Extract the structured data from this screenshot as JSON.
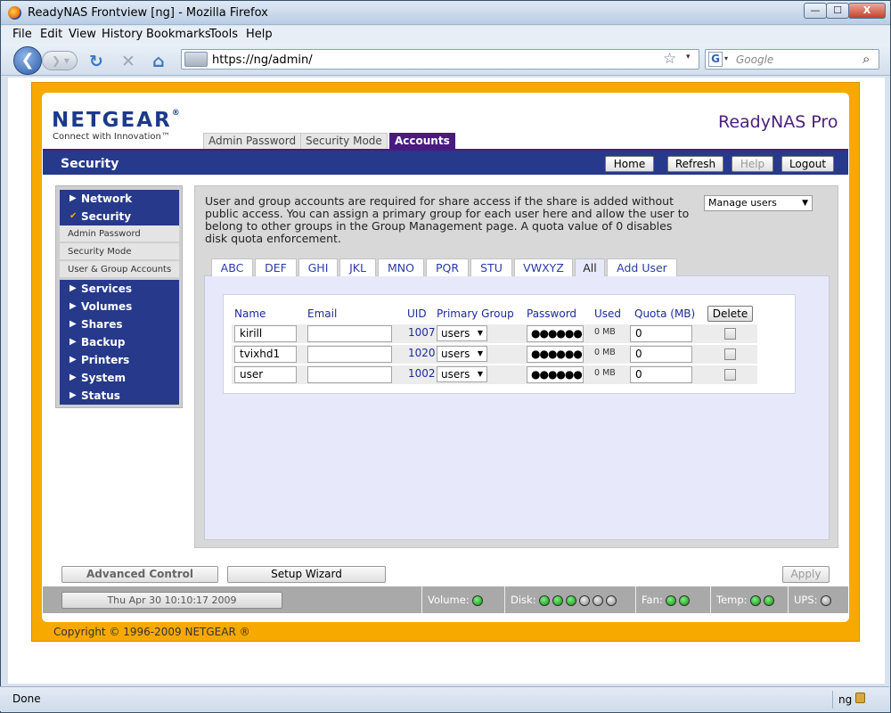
{
  "window": {
    "title": "ReadyNAS Frontview [ng] - Mozilla Firefox",
    "min": "—",
    "max": "☐",
    "close": "X"
  },
  "menu": [
    "File",
    "Edit",
    "View",
    "History",
    "Bookmarks",
    "Tools",
    "Help"
  ],
  "nav": {
    "url": "https://ng/admin/",
    "search_placeholder": "Google"
  },
  "header": {
    "logo": "NETGEAR",
    "tagline": "Connect with Innovation™",
    "product": "ReadyNAS Pro"
  },
  "top_tabs": [
    {
      "label": "Admin Password",
      "active": false
    },
    {
      "label": "Security Mode",
      "active": false
    },
    {
      "label": "Accounts",
      "active": true
    }
  ],
  "section_title": "Security",
  "header_buttons": {
    "home": "Home",
    "refresh": "Refresh",
    "help": "Help",
    "logout": "Logout"
  },
  "sidebar": {
    "network": "Network",
    "security": "Security",
    "sub": [
      "Admin Password",
      "Security Mode",
      "User & Group Accounts"
    ],
    "services": "Services",
    "volumes": "Volumes",
    "shares": "Shares",
    "backup": "Backup",
    "printers": "Printers",
    "system": "System",
    "status": "Status"
  },
  "intro": "User and group accounts are required for share access if the share is added without public access. You can assign a primary group for each user here and allow the user to belong to other groups in the Group Management page. A quota value of 0 disables disk quota enforcement.",
  "manage_select": "Manage users",
  "letter_tabs": [
    "ABC",
    "DEF",
    "GHI",
    "JKL",
    "MNO",
    "PQR",
    "STU",
    "VWXYZ",
    "All",
    "Add User"
  ],
  "table": {
    "headers": {
      "name": "Name",
      "email": "Email",
      "uid": "UID",
      "group": "Primary Group",
      "password": "Password",
      "used": "Used",
      "quota": "Quota (MB)",
      "delete": "Delete"
    },
    "rows": [
      {
        "name": "kirill",
        "email": "",
        "uid": "1007",
        "group": "users",
        "password": "●●●●●●",
        "used": "0 MB",
        "quota": "0"
      },
      {
        "name": "tvixhd1",
        "email": "",
        "uid": "1020",
        "group": "users",
        "password": "●●●●●●",
        "used": "0 MB",
        "quota": "0"
      },
      {
        "name": "user",
        "email": "",
        "uid": "1002",
        "group": "users",
        "password": "●●●●●●",
        "used": "0 MB",
        "quota": "0"
      }
    ]
  },
  "bottom_buttons": {
    "advanced": "Advanced Control",
    "wizard": "Setup Wizard",
    "apply": "Apply"
  },
  "status": {
    "datetime": "Thu Apr 30  10:10:17 2009",
    "volume": "Volume:",
    "disk": "Disk:",
    "fan": "Fan:",
    "temp": "Temp:",
    "ups": "UPS:"
  },
  "copyright": "Copyright © 1996-2009 NETGEAR ®",
  "ff_status": {
    "done": "Done",
    "host": "ng"
  }
}
